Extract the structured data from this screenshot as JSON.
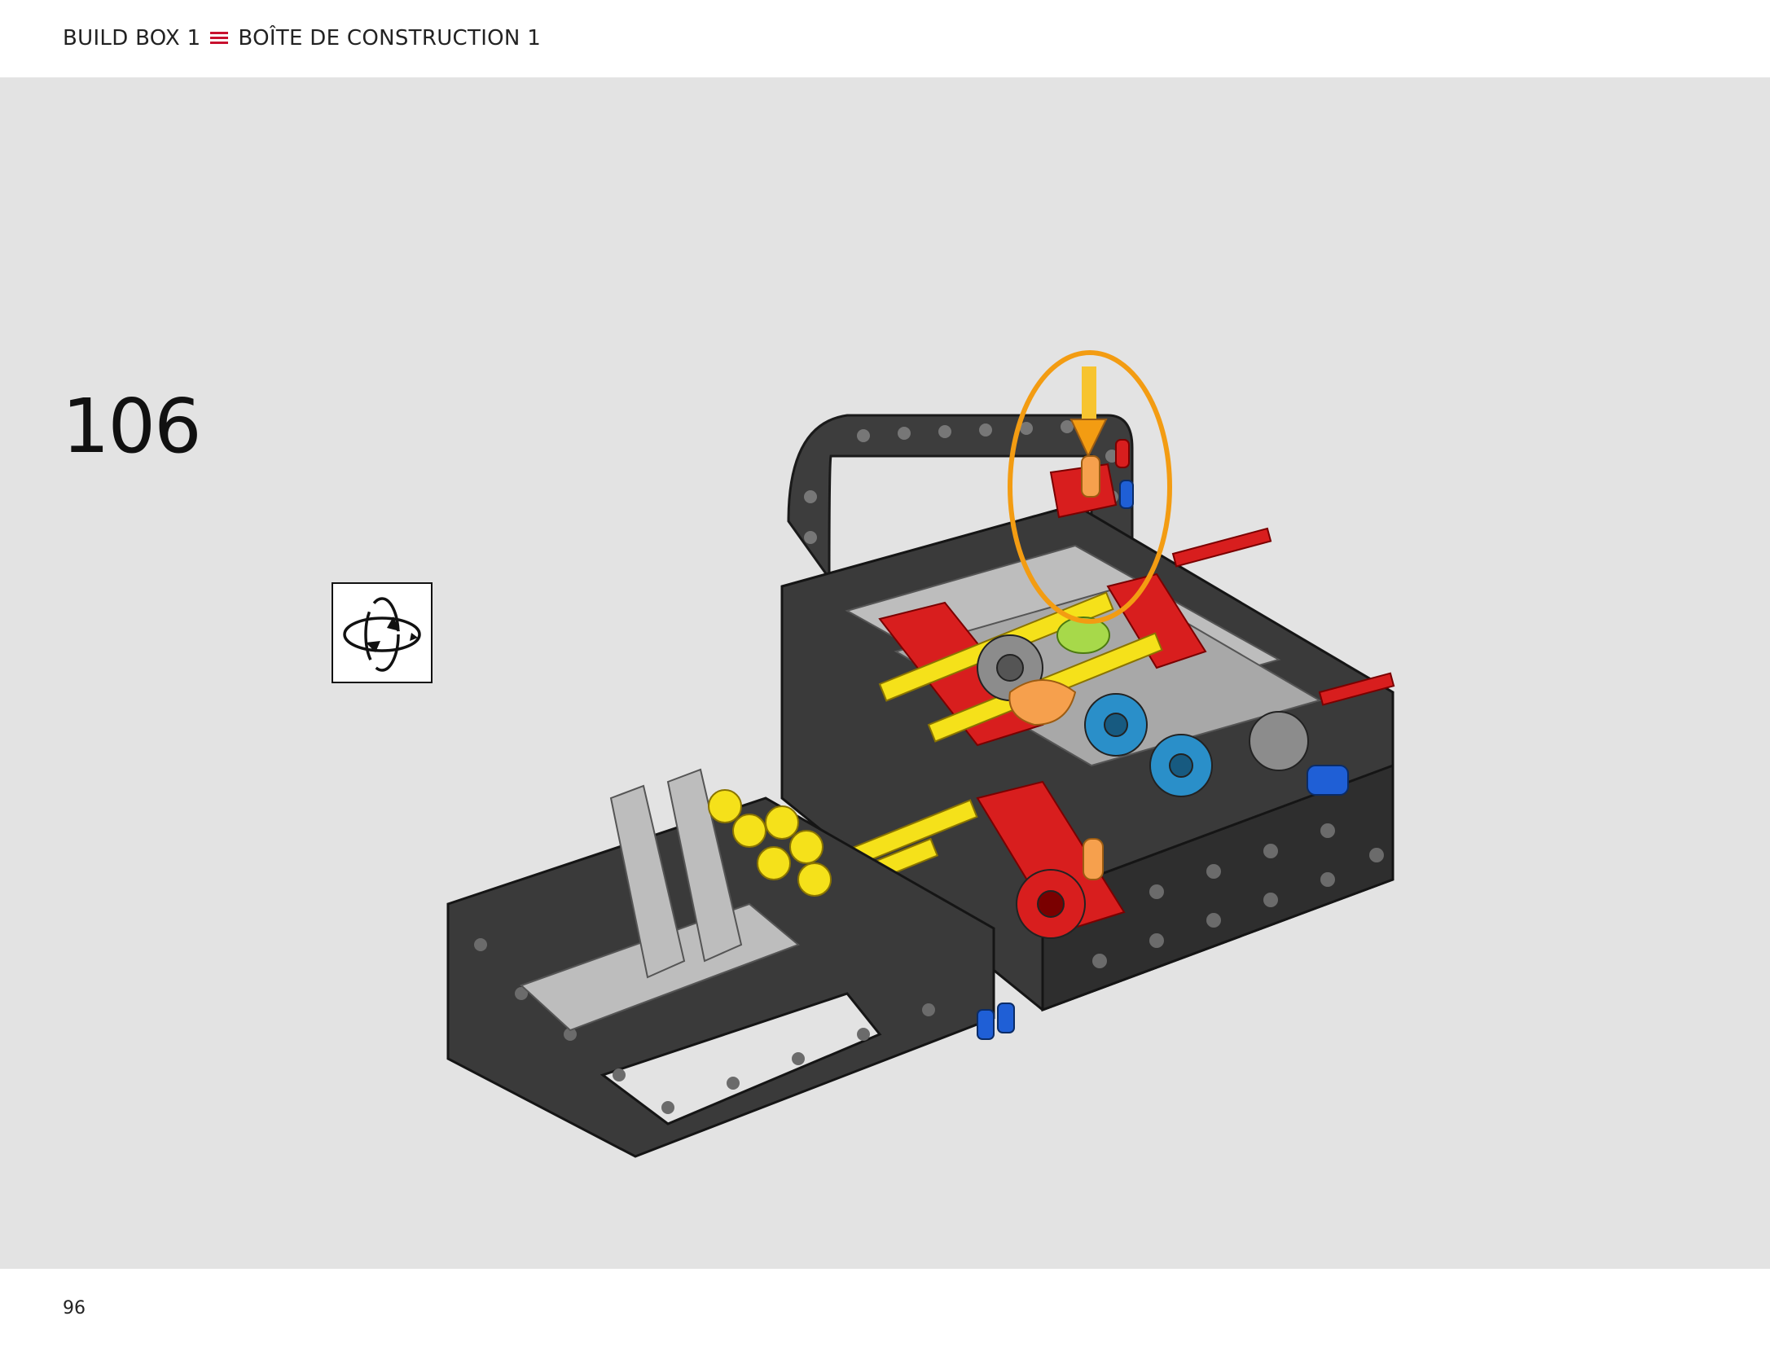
{
  "header": {
    "build_box_en": "BUILD BOX 1",
    "build_box_fr": "BOÎTE DE CONSTRUCTION 1",
    "separator_icon": "triple-line-icon",
    "separator_color": "#c8102e"
  },
  "colors": {
    "canvas_background": "#e3e3e3",
    "callout_ring": "#f39c12"
  },
  "step": {
    "number": "106",
    "rotate_icon": "rotate-model-icon"
  },
  "footer": {
    "page_number": "96"
  }
}
